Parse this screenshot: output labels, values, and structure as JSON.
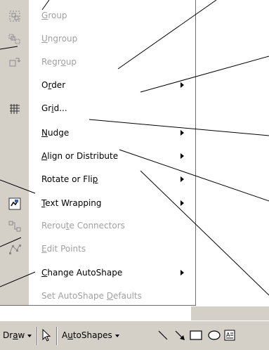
{
  "menu": {
    "items": [
      {
        "label": "Group",
        "mnemonic": "G",
        "rest": "roup",
        "icon": "group-icon",
        "enabled": false,
        "submenu": false
      },
      {
        "label": "Ungroup",
        "mnemonic": "U",
        "rest": "ngroup",
        "icon": "ungroup-icon",
        "enabled": false,
        "submenu": false
      },
      {
        "label": "Regroup",
        "pre": "Regr",
        "mnemonic": "o",
        "post": "up",
        "icon": "regroup-icon",
        "enabled": false,
        "submenu": false
      },
      {
        "label": "Order",
        "pre": "O",
        "mnemonic": "r",
        "post": "der",
        "icon": "",
        "enabled": true,
        "submenu": true
      },
      {
        "label": "Grid...",
        "pre": "Gr",
        "mnemonic": "i",
        "post": "d...",
        "icon": "grid-icon",
        "enabled": true,
        "submenu": false
      },
      {
        "label": "Nudge",
        "mnemonic": "N",
        "rest": "udge",
        "icon": "",
        "enabled": true,
        "submenu": true
      },
      {
        "label": "Align or Distribute",
        "mnemonic": "A",
        "rest": "lign or Distribute",
        "icon": "",
        "enabled": true,
        "submenu": true
      },
      {
        "label": "Rotate or Flip",
        "pre": "Rotate or Fli",
        "mnemonic": "p",
        "post": "",
        "icon": "",
        "enabled": true,
        "submenu": true
      },
      {
        "label": "Text Wrapping",
        "mnemonic": "T",
        "rest": "ext Wrapping",
        "icon": "text-wrapping-icon",
        "enabled": true,
        "submenu": true
      },
      {
        "label": "Reroute Connectors",
        "pre": "Rerou",
        "mnemonic": "t",
        "post": "e Connectors",
        "icon": "reroute-connectors-icon",
        "enabled": false,
        "submenu": false
      },
      {
        "label": "Edit Points",
        "mnemonic": "E",
        "rest": "dit Points",
        "icon": "edit-points-icon",
        "enabled": false,
        "submenu": false
      },
      {
        "label": "Change AutoShape",
        "mnemonic": "C",
        "rest": "hange AutoShape",
        "icon": "",
        "enabled": true,
        "submenu": true
      },
      {
        "label": "Set AutoShape Defaults",
        "pre": "Set AutoShape ",
        "mnemonic": "D",
        "post": "efaults",
        "icon": "",
        "enabled": false,
        "submenu": false
      }
    ]
  },
  "toolbar": {
    "draw": {
      "pre": "Dr",
      "mnemonic": "a",
      "post": "w"
    },
    "autoshapes": {
      "pre": "A",
      "mnemonic": "u",
      "post": "toShapes"
    },
    "icons": [
      "select-objects-icon",
      "line-icon",
      "arrow-icon",
      "rectangle-icon",
      "oval-icon",
      "text-box-icon"
    ]
  },
  "colors": {
    "gutter": "#d4d0c8",
    "toolbar": "#d4d0c8",
    "disabled_text": "#a0a0a0",
    "border": "#6e6e6e"
  }
}
